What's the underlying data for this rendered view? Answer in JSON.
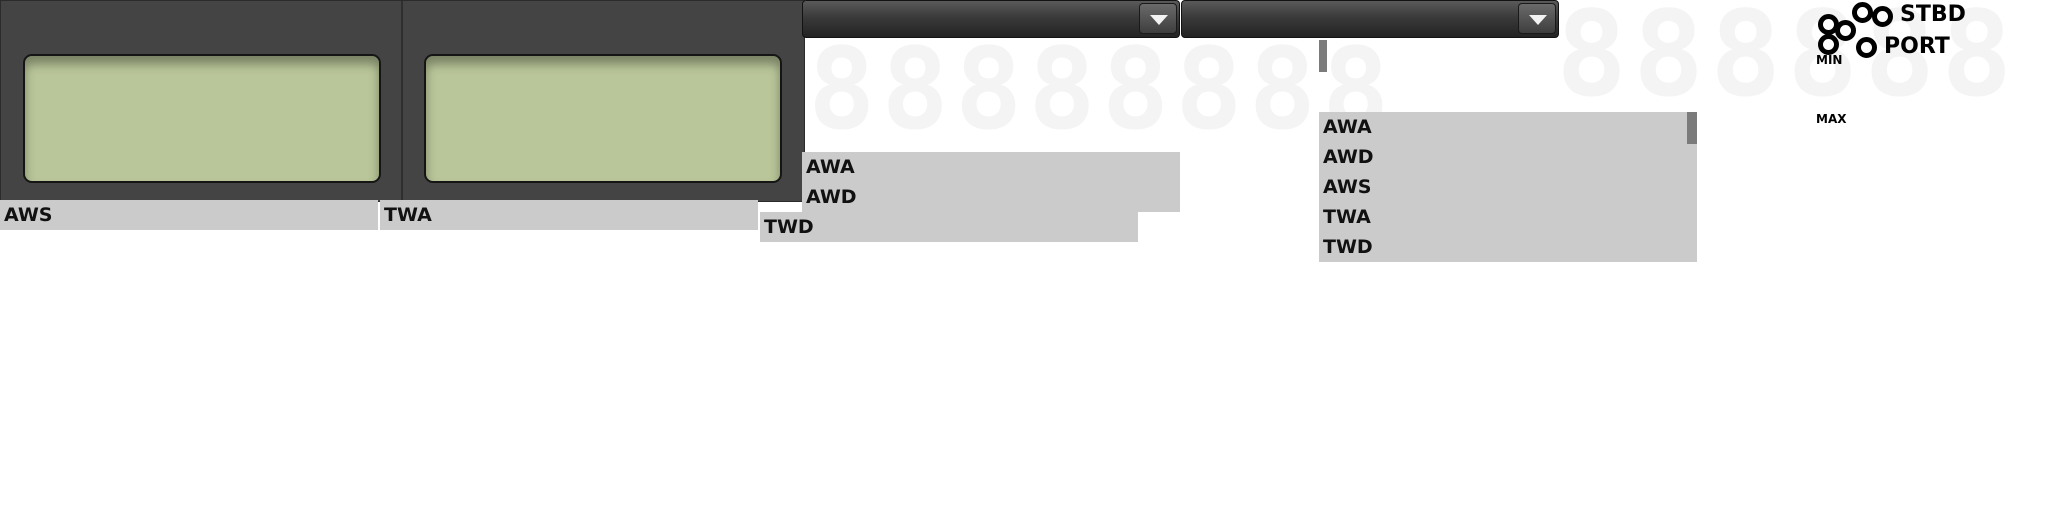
{
  "instruments": {
    "left": {
      "label": "AWS"
    },
    "right": {
      "label": "TWA"
    }
  },
  "list_a": {
    "items": [
      "AWA",
      "AWD"
    ]
  },
  "list_a_extra": "TWD",
  "list_b": {
    "items": [
      "AWA",
      "AWD",
      "AWS",
      "TWA",
      "TWD"
    ]
  },
  "ghost_digits": {
    "a": "88888888",
    "b": "888888"
  },
  "side": {
    "stbd": "STBD",
    "port": "PORT",
    "min": "MIN",
    "max": "MAX"
  },
  "colors": {
    "panel": "#444444",
    "lcd": "#b9c699",
    "label_bg": "#cbcbcb"
  }
}
